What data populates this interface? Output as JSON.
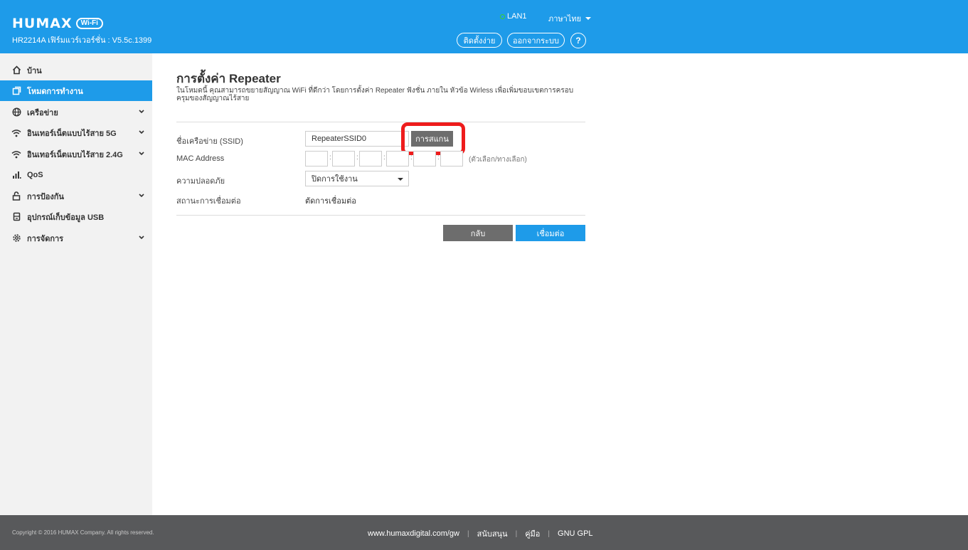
{
  "header": {
    "brand": "HUMAX",
    "brand_badge": "Wi-Fi",
    "firmware_line": "HR2214A เฟิร์มแวร์เวอร์ชั่น : V5.5c.1399",
    "lan_status": "LAN1",
    "language": "ภาษาไทย",
    "easy_setup": "ติดตั้งง่าย",
    "logout": "ออกจากระบบ",
    "help": "?"
  },
  "sidebar": {
    "items": [
      {
        "label": "บ้าน",
        "icon": "home-icon"
      },
      {
        "label": "โหมดการทำงาน",
        "icon": "mode-icon",
        "active": true
      },
      {
        "label": "เครือข่าย",
        "icon": "globe-icon"
      },
      {
        "label": "อินเทอร์เน็ตแบบไร้สาย 5G",
        "icon": "wifi-icon"
      },
      {
        "label": "อินเทอร์เน็ตแบบไร้สาย 2.4G",
        "icon": "wifi-icon"
      },
      {
        "label": "QoS",
        "icon": "bars-icon"
      },
      {
        "label": "การป้องกัน",
        "icon": "lock-icon"
      },
      {
        "label": "อุปกรณ์เก็บข้อมูล USB",
        "icon": "usb-icon"
      },
      {
        "label": "การจัดการ",
        "icon": "gear-icon"
      }
    ]
  },
  "main": {
    "title": "การตั้งค่า Repeater",
    "description": "ในโหมดนี้ คุณสามารถขยายสัญญาณ WiFi ที่ดีกว่า โดยการตั้งค่า Repeater ฟังชั่น ภายใน หัวข้อ Wirless เพื่อเพิ่มขอบเขตการครอบครุมของสัญญาณไร้สาย",
    "ssid_label": "ชื่อเครือข่าย (SSID)",
    "ssid_value": "RepeaterSSID0",
    "scan_button": "การสแกน",
    "mac_label": "MAC Address",
    "mac_hint": "(ตัวเลือก/ทางเลือก)",
    "security_label": "ความปลอดภัย",
    "security_value": "ปิดการใช้งาน",
    "status_label": "สถานะการเชื่อมต่อ",
    "status_value": "ตัดการเชื่อมต่อ",
    "back_button": "กลับ",
    "connect_button": "เชื่อมต่อ"
  },
  "footer": {
    "copyright": "Copyright © 2016 HUMAX Company. All rights reserved.",
    "website": "www.humaxdigital.com/gw",
    "support": "สนับสนุน",
    "manual": "คู่มือ",
    "gpl": "GNU GPL"
  },
  "colors": {
    "brand_blue": "#1e9be9",
    "button_gray": "#6d6d6d",
    "footer_gray": "#58595b",
    "highlight_red": "#ee1c1c",
    "lan_green": "#3ad12f"
  }
}
